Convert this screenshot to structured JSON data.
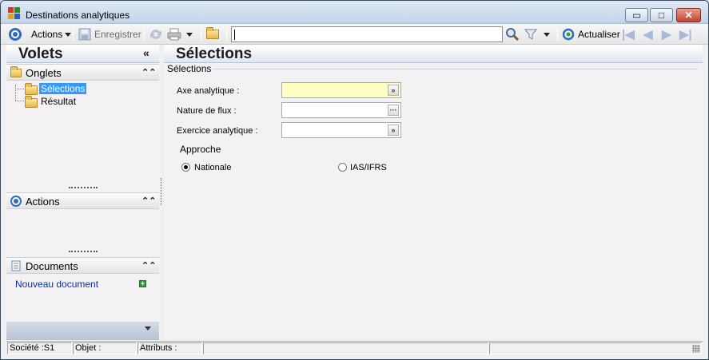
{
  "window": {
    "title": "Destinations analytiques",
    "min_glyph": "▭",
    "max_glyph": "□",
    "close_glyph": "✕"
  },
  "toolbar": {
    "actions_label": "Actions",
    "save_label": "Enregistrer",
    "search_value": "",
    "refresh_label": "Actualiser",
    "nav_first_glyph": "|◀",
    "nav_prev_glyph": "◀",
    "nav_next_glyph": "▶",
    "nav_last_glyph": "▶|"
  },
  "left_panel": {
    "title": "Volets",
    "collapse_glyph": "«",
    "sections": {
      "onglets": {
        "title": "Onglets",
        "items": [
          {
            "label": "Sélections",
            "selected": true
          },
          {
            "label": "Résultat",
            "selected": false
          }
        ]
      },
      "actions": {
        "title": "Actions"
      },
      "documents": {
        "title": "Documents",
        "new_doc_label": "Nouveau document"
      }
    },
    "section_chevron": "⌃⌃"
  },
  "main": {
    "title": "Sélections",
    "group_label": "Sélections",
    "fields": {
      "axe": {
        "label": "Axe analytique :",
        "value": ""
      },
      "nature": {
        "label": "Nature de flux :",
        "value": ""
      },
      "exercice": {
        "label": "Exercice analytique :",
        "value": ""
      }
    },
    "approche": {
      "label": "Approche",
      "options": [
        {
          "label": "Nationale",
          "checked": true
        },
        {
          "label": "IAS/IFRS",
          "checked": false
        }
      ]
    }
  },
  "status_bar": {
    "societe": "Société :S1",
    "objet": "Objet :",
    "attributs": "Attributs :"
  },
  "icons": {
    "accent": "#2f6bc1",
    "folder": "#e7b94a",
    "selected_bg": "#3399ff",
    "add_green": "#3a9a36"
  }
}
